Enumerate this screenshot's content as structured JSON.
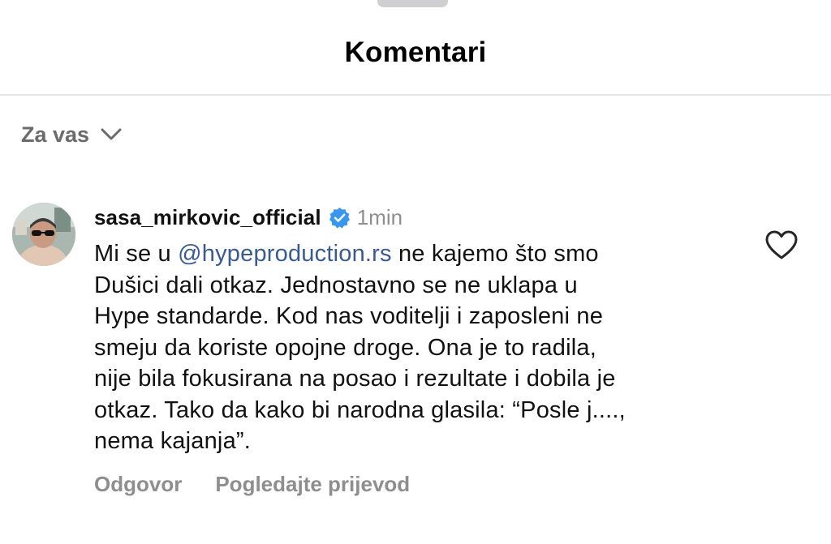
{
  "header": {
    "title": "Komentari"
  },
  "filter": {
    "label": "Za vas",
    "icon": "chevron-down-icon"
  },
  "comment": {
    "username": "sasa_mirkovic_official",
    "verified": true,
    "time": "1min",
    "text_prefix": "Mi se u ",
    "mention": "@hypeproduction.rs",
    "lines": [
      " ne kajemo što smo",
      "Dušici dali otkaz. Jednostavno se ne uklapa u",
      "Hype standarde. Kod nas voditelji i zaposleni ne",
      "smeju da koriste opojne droge. Ona je to radila,",
      "nije bila fokusirana na posao i rezultate i dobila je",
      "otkaz. Tako da kako bi narodna glasila: “Posle j....,",
      "nema kajanja”."
    ],
    "actions": {
      "reply": "Odgovor",
      "translate": "Pogledajte prijevod"
    }
  },
  "colors": {
    "accent_link": "#3a5a94",
    "verified_badge": "#3897f0",
    "muted_text": "#8e8e8e",
    "divider": "#e6e6e6"
  }
}
